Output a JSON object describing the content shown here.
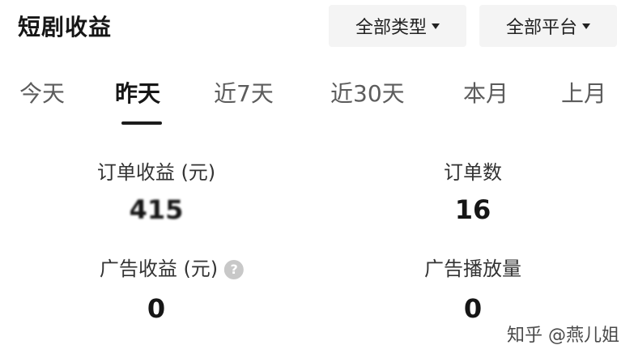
{
  "header": {
    "title": "短剧收益",
    "filters": [
      {
        "label": "全部类型"
      },
      {
        "label": "全部平台"
      }
    ]
  },
  "tabs": [
    {
      "label": "今天",
      "active": false
    },
    {
      "label": "昨天",
      "active": true
    },
    {
      "label": "近7天",
      "active": false
    },
    {
      "label": "近30天",
      "active": false
    },
    {
      "label": "本月",
      "active": false
    },
    {
      "label": "上月",
      "active": false
    }
  ],
  "metrics": {
    "order_revenue": {
      "label": "订单收益 (元)",
      "value": "415"
    },
    "order_count": {
      "label": "订单数",
      "value": "16"
    },
    "ad_revenue": {
      "label": "广告收益 (元)",
      "value": "0",
      "help_icon": "?"
    },
    "ad_plays": {
      "label": "广告播放量",
      "value": "0"
    }
  },
  "watermark": "知乎 @燕儿姐"
}
